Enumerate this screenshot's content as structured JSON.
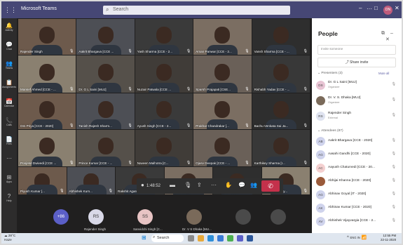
{
  "window": {
    "title": "Microsoft Teams",
    "search_placeholder": "Search",
    "user_initials": "DN",
    "more": "···"
  },
  "rail": [
    {
      "icon": "bell-icon",
      "glyph": "🔔",
      "label": "Activity"
    },
    {
      "icon": "chat-icon",
      "glyph": "💬",
      "label": "Chat"
    },
    {
      "icon": "teams-icon",
      "glyph": "👥",
      "label": "Teams"
    },
    {
      "icon": "assignments-icon",
      "glyph": "📋",
      "label": "Assignments"
    },
    {
      "icon": "calendar-icon",
      "glyph": "📅",
      "label": "Calendar"
    },
    {
      "icon": "calls-icon",
      "glyph": "📞",
      "label": "Calls"
    },
    {
      "icon": "files-icon",
      "glyph": "📄",
      "label": "Files"
    },
    {
      "icon": "more-icon",
      "glyph": "···",
      "label": ""
    },
    {
      "icon": "apps-icon",
      "glyph": "⊞",
      "label": "Apps"
    },
    {
      "icon": "help-icon",
      "glyph": "?",
      "label": "Help"
    }
  ],
  "tiles": [
    [
      "Rajender Singh",
      "Aakrit Bhargava [CCE ...",
      "Yash Sharma [CCE - 2...",
      "Aman Panwar [CCE - 2...",
      "Vansh Sharma [CCE - ..."
    ],
    [
      "Mansef Ahmed [CCE - ...",
      "Dr. G L Saini [MUJ]",
      "Nuzair Patwala [CCE ...",
      "Sparsh Prajapati [CSE...",
      "Rishabh Yadav [CCE - ..."
    ],
    [
      "Om Priya [CCE - 2020]",
      "Tanish Rajesh Sharm...",
      "Ayush Singh [CCE - 2...",
      "Prakhar Chandrakar [...",
      "Bachu Venkata Sai Ja..."
    ],
    [
      "Poojesd Dwivedi [CCE ...",
      "Prince Kumar [CCE - ...",
      "Naveen Malhotra [C...",
      "Ojasv Deepak [CCE - ...",
      "Karthikey Sharma [I..."
    ],
    [
      "Piyush Kumar [...",
      "Abhishek Kum...",
      "Rakshit Agarwal...",
      "Priyanshu Ranja...",
      "Pranjal Srivastav...",
      "Abhishek Vijay..."
    ]
  ],
  "controls": {
    "timer": "1:48:52",
    "leave_glyph": "✆"
  },
  "strip": [
    {
      "initials": "+86",
      "name": ""
    },
    {
      "initials": "RS",
      "name": "Rajender Singh"
    },
    {
      "initials": "SS",
      "name": "Sanvidchi Singh [C..."
    },
    {
      "initials": "",
      "name": "Dr. V S Dhaka [MU..."
    },
    {
      "initials": "",
      "name": ""
    },
    {
      "initials": "",
      "name": ""
    }
  ],
  "panel": {
    "title": "People",
    "invite_placeholder": "Invite someone",
    "share_invite": "Share invite",
    "presenters_label": "Presenters (3)",
    "mute_all": "Mute all",
    "presenters": [
      {
        "initials": "DS",
        "name": "Dr. G L Saini [MUJ]",
        "role": "Organizer",
        "color": "#e8c4d4"
      },
      {
        "initials": "",
        "name": "Dr. V. S. Dhaka [MUJ]",
        "role": "Organizer",
        "color": "#7a6a5a"
      },
      {
        "initials": "RS",
        "name": "Rajender Singh",
        "role": "External",
        "color": "#dfe3f0"
      }
    ],
    "attendees_label": "Attendees (87)",
    "attendees": [
      {
        "initials": "AB",
        "name": "Aakrit Bhargava [CCE - 2020]",
        "color": "#cfd3ec"
      },
      {
        "initials": "AG",
        "name": "Aasahi Gandhi [CCE - 2020]",
        "color": "#cfd3ec"
      },
      {
        "initials": "AC",
        "name": "Aayush Chaturvedi [CCE - 20...",
        "color": "#f4d0d0"
      },
      {
        "initials": "",
        "name": "Abhijai Khanna [CCE - 2020]",
        "color": "#9a5a3a"
      },
      {
        "initials": "AG",
        "name": "Abhinav Goyal [IT - 2020]",
        "color": "#cfd3ec"
      },
      {
        "initials": "AK",
        "name": "Abhinav Kumar [CCE - 2020]",
        "color": "#cfd3ec"
      },
      {
        "initials": "AV",
        "name": "Abhishek Vijayvargia [CCE - 2...",
        "color": "#cfd3ec"
      }
    ]
  },
  "taskbar": {
    "weather_temp": "28°C",
    "weather_desc": "Haze",
    "search_label": "Search",
    "lang": "ENG IN",
    "time": "12:55 PM",
    "date": "22-11-2020"
  }
}
